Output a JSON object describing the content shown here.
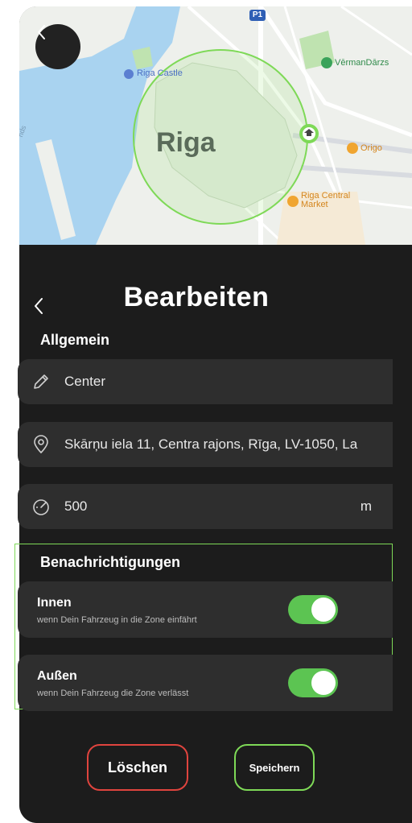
{
  "map": {
    "city_label": "Riga",
    "pois": {
      "castle": "Riga Castle",
      "vermandarzs": "VērmanDārzs",
      "origo": "Origo",
      "central_market": "Riga Central Market",
      "parking": "P1",
      "edge_text": "nds"
    }
  },
  "header": {
    "title": "Bearbeiten"
  },
  "general": {
    "section_title": "Allgemein",
    "name_value": "Center",
    "address_value": "Skārņu iela 11, Centra rajons, Rīga, LV-1050, La",
    "radius_value": "500",
    "radius_unit": "m"
  },
  "notifications": {
    "section_title": "Benachrichtigungen",
    "inside": {
      "title": "Innen",
      "subtitle": "wenn Dein Fahrzeug in die Zone einfährt",
      "enabled": true
    },
    "outside": {
      "title": "Außen",
      "subtitle": "wenn Dein Fahrzeug die Zone verlässt",
      "enabled": true
    }
  },
  "actions": {
    "delete_label": "Löschen",
    "save_label": "Speichern"
  },
  "colors": {
    "accent_green": "#7ed957",
    "toggle_on": "#5cc452",
    "danger_red": "#e0443e",
    "water": "#a9d3f0",
    "park": "#bfe3b0"
  }
}
